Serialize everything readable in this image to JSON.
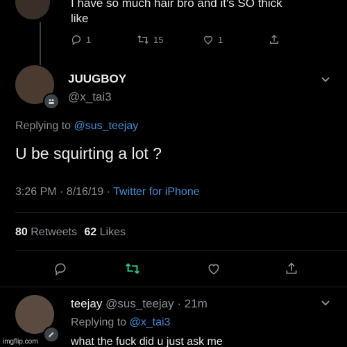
{
  "prev_tweet": {
    "text_line1": "I have so much hair bro and it's SO thick",
    "text_line2": "like",
    "reply_count": "1",
    "retweet_count": "15",
    "like_count": "1"
  },
  "main_tweet": {
    "display_name": "JUUGBOY",
    "handle": "@x_tai3",
    "replying_prefix": "Replying to",
    "replying_to": "@sus_teejay",
    "text": "U be squirting a lot ?",
    "time_date": "3:26 PM · 8/16/19 · ",
    "source": "Twitter for iPhone",
    "retweets_count": "80",
    "retweets_label": "Retweets",
    "likes_count": "62",
    "likes_label": "Likes"
  },
  "reply_tweet": {
    "display_name": "teejay",
    "handle_time": "@sus_teejay · 21m",
    "replying_prefix": "Replying to",
    "replying_to": "@x_tai3",
    "text": "what the fuck did u just ask me"
  },
  "watermark": "imgflip.com",
  "colors": {
    "background": "#000000",
    "link": "#3d8fd6",
    "retweet_green": "#19cf86",
    "muted": "#8a8f94"
  },
  "icons": [
    "reply-icon",
    "retweet-icon",
    "like-icon",
    "share-icon",
    "chevron-down-icon",
    "pen-badge-icon"
  ]
}
